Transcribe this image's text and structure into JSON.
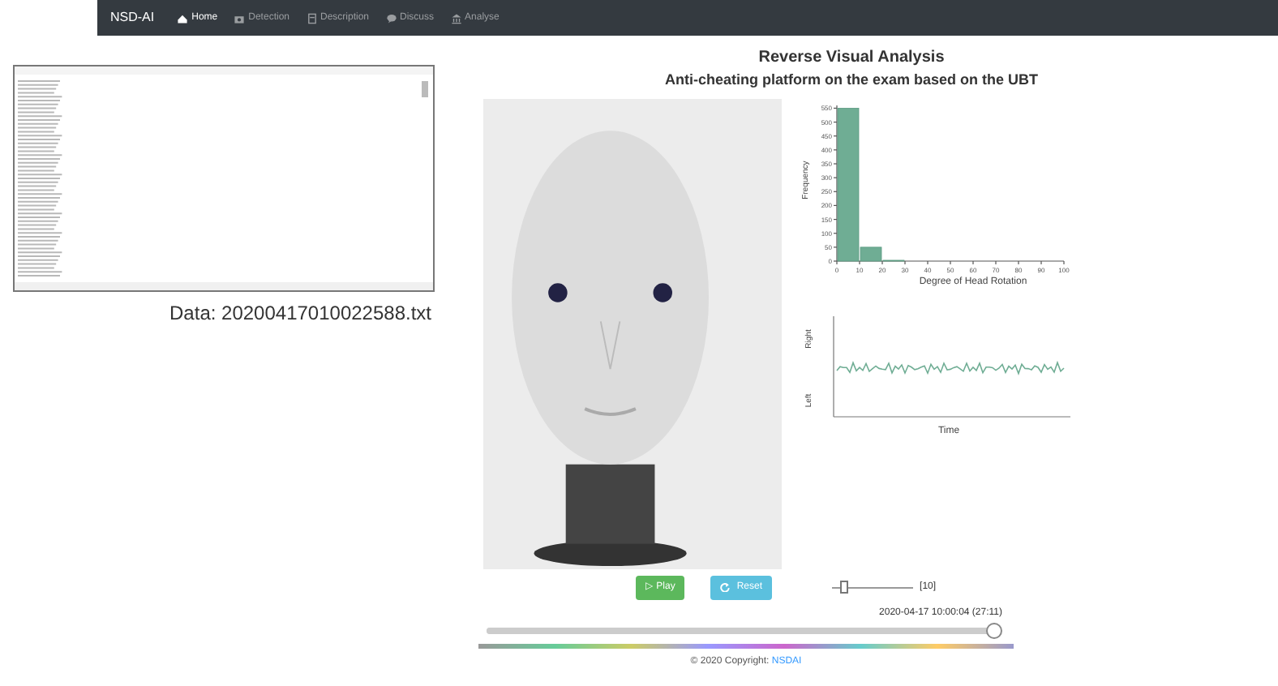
{
  "navbar": {
    "brand": "NSD-AI",
    "items": [
      {
        "label": "Home",
        "selected": true
      },
      {
        "label": "Detection",
        "selected": false
      },
      {
        "label": "Description",
        "selected": false
      },
      {
        "label": "Discuss",
        "selected": false
      },
      {
        "label": "Analyse",
        "selected": false
      }
    ]
  },
  "data_file": {
    "caption": "Data: 20200417010022588.txt"
  },
  "title": "Reverse Visual Analysis",
  "subtitle": "Anti-cheating platform on the exam based on the UBT",
  "histogram": {
    "chart_data": {
      "type": "bar",
      "xlabel": "Degree of Head Rotation",
      "ylabel": "Frequency",
      "x": [
        5,
        15,
        25
      ],
      "values": [
        550,
        50,
        3
      ],
      "xlim": [
        0,
        100
      ],
      "xticks": [
        0,
        10,
        20,
        30,
        40,
        50,
        60,
        70,
        80,
        90,
        100
      ],
      "yticks": [
        0,
        50,
        100,
        150,
        200,
        250,
        300,
        350,
        400,
        450,
        500,
        550
      ],
      "ylim": [
        0,
        560
      ]
    }
  },
  "rotation_plot": {
    "ylabel_top": "Right",
    "ylabel_bottom": "Left",
    "xlabel": "Time"
  },
  "controls": {
    "play": "▷ Play",
    "reset": "Reset",
    "speed": {
      "level": 0.15,
      "reading": "[10]"
    }
  },
  "timeline": {
    "timestamp": "2020-04-17 10:00:04 (27:11)",
    "level": 1.0
  },
  "footer": {
    "text": "© 2020 Copyright: ",
    "link": "NSDAI"
  }
}
